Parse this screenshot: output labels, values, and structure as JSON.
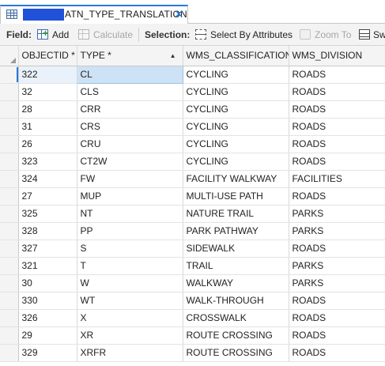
{
  "tab": {
    "title": "ATN_TYPE_TRANSLATION",
    "close_glyph": "✕"
  },
  "toolbar": {
    "field_label": "Field:",
    "add_label": "Add",
    "calculate_label": "Calculate",
    "selection_label": "Selection:",
    "select_by_attributes_label": "Select By Attributes",
    "zoom_to_label": "Zoom To",
    "switch_label": "Sw"
  },
  "columns": [
    "OBJECTID *",
    "TYPE *",
    "WMS_CLASSIFICATION",
    "WMS_DIVISION"
  ],
  "rows": [
    {
      "objectid": "322",
      "type": "CL",
      "classification": "CYCLING",
      "division": "ROADS"
    },
    {
      "objectid": "32",
      "type": "CLS",
      "classification": "CYCLING",
      "division": "ROADS"
    },
    {
      "objectid": "28",
      "type": "CRR",
      "classification": "CYCLING",
      "division": "ROADS"
    },
    {
      "objectid": "31",
      "type": "CRS",
      "classification": "CYCLING",
      "division": "ROADS"
    },
    {
      "objectid": "26",
      "type": "CRU",
      "classification": "CYCLING",
      "division": "ROADS"
    },
    {
      "objectid": "323",
      "type": "CT2W",
      "classification": "CYCLING",
      "division": "ROADS"
    },
    {
      "objectid": "324",
      "type": "FW",
      "classification": "FACILITY WALKWAY",
      "division": "FACILITIES"
    },
    {
      "objectid": "27",
      "type": "MUP",
      "classification": "MULTI-USE PATH",
      "division": "ROADS"
    },
    {
      "objectid": "325",
      "type": "NT",
      "classification": "NATURE TRAIL",
      "division": "PARKS"
    },
    {
      "objectid": "328",
      "type": "PP",
      "classification": "PARK PATHWAY",
      "division": "PARKS"
    },
    {
      "objectid": "327",
      "type": "S",
      "classification": "SIDEWALK",
      "division": "ROADS"
    },
    {
      "objectid": "321",
      "type": "T",
      "classification": "TRAIL",
      "division": "PARKS"
    },
    {
      "objectid": "30",
      "type": "W",
      "classification": "WALKWAY",
      "division": "PARKS"
    },
    {
      "objectid": "330",
      "type": "WT",
      "classification": "WALK-THROUGH",
      "division": "ROADS"
    },
    {
      "objectid": "326",
      "type": "X",
      "classification": "CROSSWALK",
      "division": "ROADS"
    },
    {
      "objectid": "29",
      "type": "XR",
      "classification": "ROUTE CROSSING",
      "division": "ROADS"
    },
    {
      "objectid": "329",
      "type": "XRFR",
      "classification": "ROUTE CROSSING",
      "division": "ROADS"
    }
  ],
  "colors": {
    "accent": "#2b79d8",
    "selected_cell": "#cde3f5",
    "redaction": "#1f52d8"
  }
}
